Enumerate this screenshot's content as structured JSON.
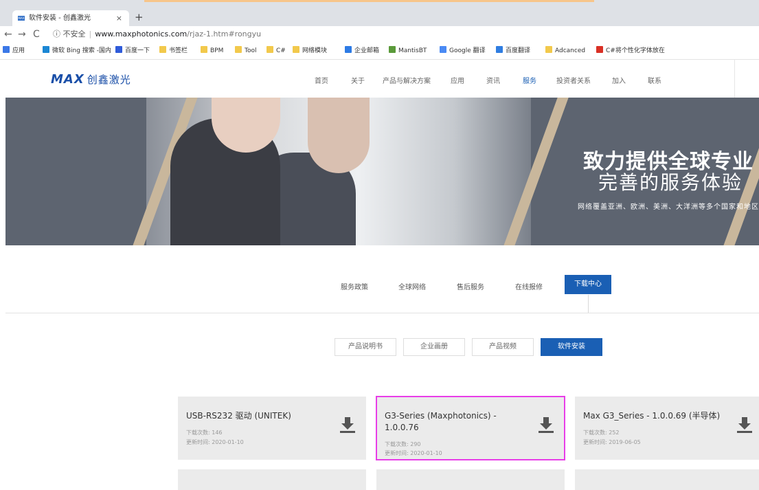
{
  "browser": {
    "tab_title": "软件安装 - 创鑫激光",
    "tab_close": "×",
    "new_tab": "+",
    "security_label": "不安全",
    "url_host": "www.maxphotonics.com",
    "url_path": "/rjaz-1.htm#rongyu",
    "bookmarks": [
      {
        "label": "应用",
        "color": "#3b78e7"
      },
      {
        "label": "微软 Bing 搜索 -国内",
        "color": "#1b87d4"
      },
      {
        "label": "百度一下",
        "color": "#2f5bd9"
      },
      {
        "label": "书签栏",
        "color": "#f2c94c"
      },
      {
        "label": "BPM",
        "color": "#f2c94c"
      },
      {
        "label": "Tool",
        "color": "#f2c94c"
      },
      {
        "label": "C#",
        "color": "#f2c94c"
      },
      {
        "label": "网络模块",
        "color": "#f2c94c"
      },
      {
        "label": "企业邮箱",
        "color": "#2d7be5"
      },
      {
        "label": "MantisBT",
        "color": "#5a9a3a"
      },
      {
        "label": "Google 翻译",
        "color": "#4a8af4"
      },
      {
        "label": "百度翻译",
        "color": "#2f7de1"
      },
      {
        "label": "Adcanced",
        "color": "#f2c94c"
      },
      {
        "label": "C#将个性化字体放在",
        "color": "#d93025"
      }
    ]
  },
  "site": {
    "logo_text": "MAX",
    "logo_cn": "创鑫激光",
    "nav": [
      "首页",
      "关于",
      "产品与解决方案",
      "应用",
      "资讯",
      "服务",
      "投资者关系",
      "加入",
      "联系"
    ],
    "nav_active": "服务"
  },
  "banner": {
    "line1": "致力提供全球专业",
    "line2": "完善的服务体验",
    "line3": "网络覆盖亚洲、欧洲、美洲、大洋洲等多个国家和地区"
  },
  "service_nav": {
    "items": [
      "服务政策",
      "全球网络",
      "售后服务",
      "在线报修"
    ],
    "active": "下载中心"
  },
  "sub_tabs": {
    "items": [
      "产品说明书",
      "企业画册",
      "产品视频"
    ],
    "active": "软件安装"
  },
  "downloads": [
    {
      "name": "USB-RS232 驱动 (UNITEK)",
      "count_label": "下载次数:",
      "count": "146",
      "date_label": "更新时间:",
      "date": "2020-01-10"
    },
    {
      "name": "G3-Series (Maxphotonics) - 1.0.0.76",
      "count_label": "下载次数:",
      "count": "290",
      "date_label": "更新时间:",
      "date": "2020-01-10"
    },
    {
      "name": "Max G3_Series - 1.0.0.69 (半导体)",
      "count_label": "下载次数:",
      "count": "252",
      "date_label": "更新时间:",
      "date": "2019-06-05"
    }
  ],
  "colors": {
    "brand": "#1a5fb4",
    "highlight": "#e83de8"
  }
}
